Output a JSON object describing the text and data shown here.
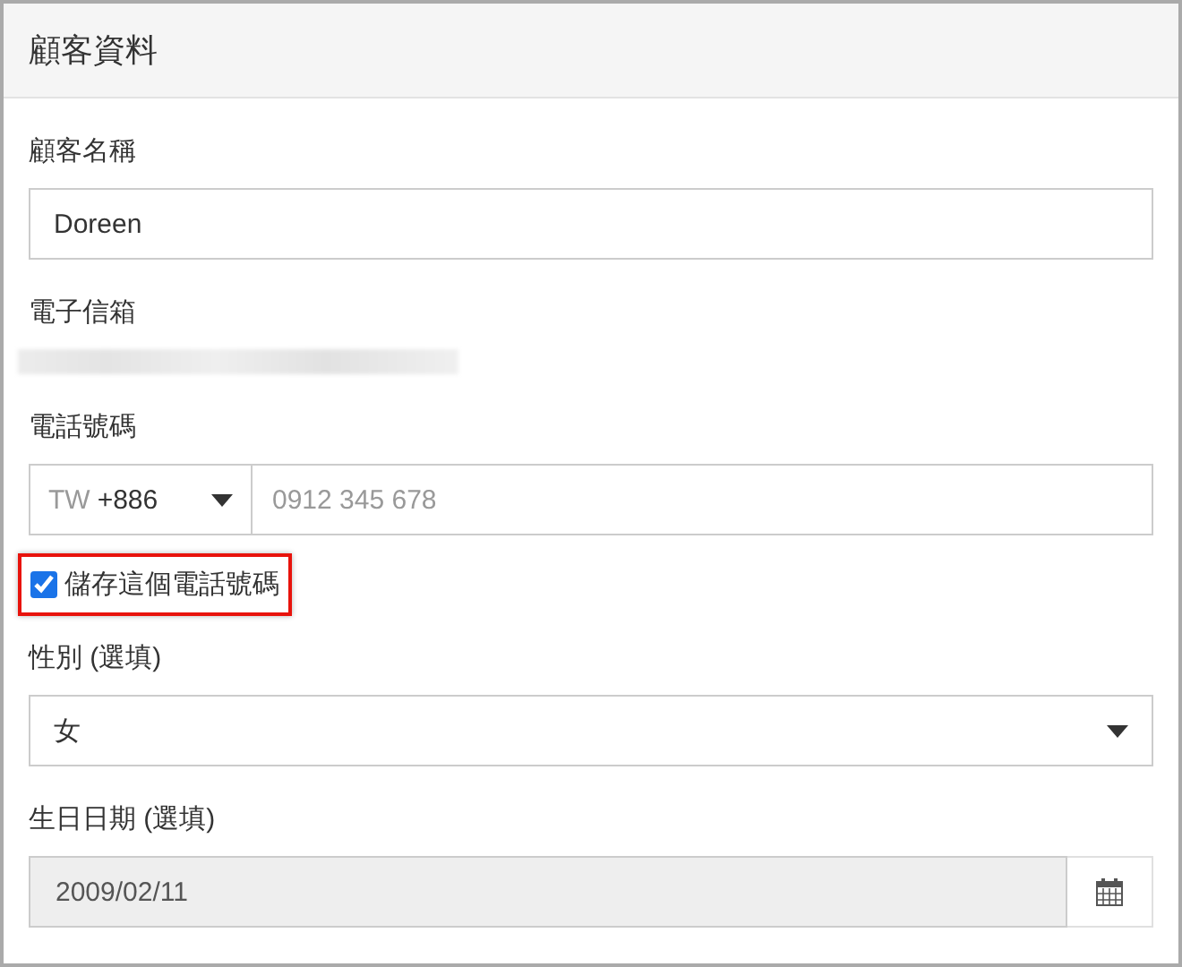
{
  "panel": {
    "title": "顧客資料"
  },
  "name_field": {
    "label": "顧客名稱",
    "value": "Doreen"
  },
  "email": {
    "label": "電子信箱",
    "redacted": true
  },
  "phone": {
    "label": "電話號碼",
    "country_code": "TW",
    "dial_code": "+886",
    "placeholder": "0912 345 678"
  },
  "save_phone": {
    "label": "儲存這個電話號碼",
    "checked": true,
    "highlighted": true
  },
  "gender": {
    "label": "性別 (選填)",
    "value": "女"
  },
  "birthday": {
    "label": "生日日期 (選填)",
    "value": "2009/02/11",
    "disabled": true
  }
}
